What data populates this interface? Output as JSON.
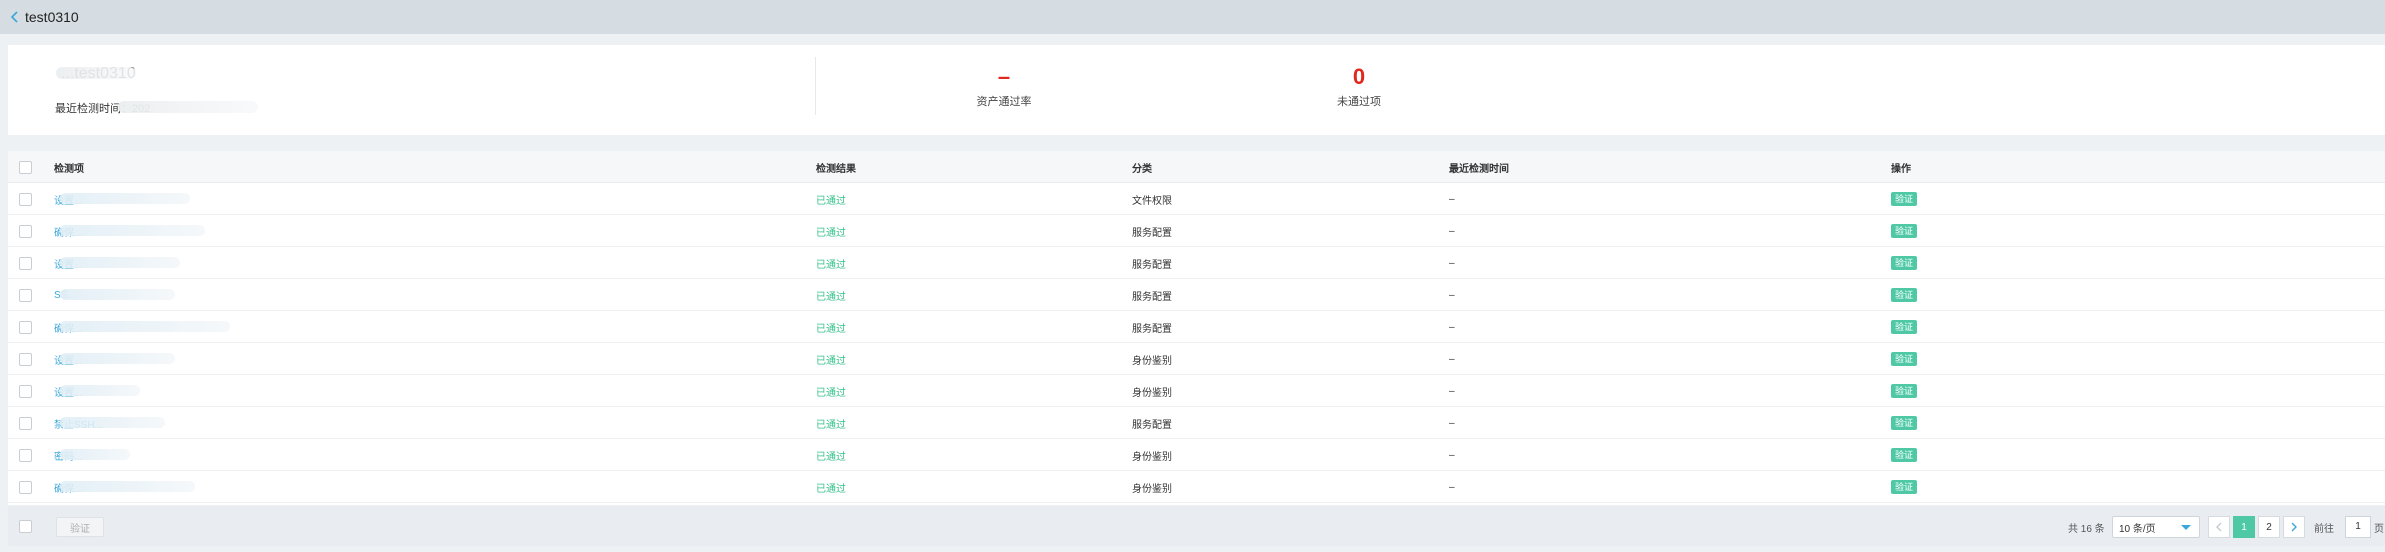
{
  "header": {
    "title": "test0310"
  },
  "summary": {
    "asset_name": "...test0310",
    "last_check_label": "最近检测时间：",
    "last_check_value": "202",
    "stats": [
      {
        "value": "–",
        "label": "资产通过率"
      },
      {
        "value": "0",
        "label": "未通过项"
      }
    ]
  },
  "table": {
    "columns": [
      "检测项",
      "检测结果",
      "分类",
      "最近检测时间",
      "操作"
    ],
    "rows": [
      {
        "item": "设置...",
        "result": "已通过",
        "category": "文件权限",
        "time": "–",
        "action": "验证"
      },
      {
        "item": "确保...",
        "result": "已通过",
        "category": "服务配置",
        "time": "–",
        "action": "验证"
      },
      {
        "item": "设置...",
        "result": "已通过",
        "category": "服务配置",
        "time": "–",
        "action": "验证"
      },
      {
        "item": "SS...",
        "result": "已通过",
        "category": "服务配置",
        "time": "–",
        "action": "验证"
      },
      {
        "item": "确保...",
        "result": "已通过",
        "category": "服务配置",
        "time": "–",
        "action": "验证"
      },
      {
        "item": "设置...",
        "result": "已通过",
        "category": "身份鉴别",
        "time": "–",
        "action": "验证"
      },
      {
        "item": "设置...",
        "result": "已通过",
        "category": "身份鉴别",
        "time": "–",
        "action": "验证"
      },
      {
        "item": "禁止SSH...",
        "result": "已通过",
        "category": "服务配置",
        "time": "–",
        "action": "验证"
      },
      {
        "item": "密码...",
        "result": "已通过",
        "category": "身份鉴别",
        "time": "–",
        "action": "验证"
      },
      {
        "item": "确保...",
        "result": "已通过",
        "category": "身份鉴别",
        "time": "–",
        "action": "验证"
      }
    ]
  },
  "footer": {
    "bulk_verify_label": "验证",
    "total_text": "共 16 条",
    "page_size": "10 条/页",
    "pages": [
      "1",
      "2"
    ],
    "current_page": "1",
    "goto_label": "前往",
    "goto_value": "1",
    "page_unit": "页"
  },
  "colors": {
    "accent": "#4fc9a5",
    "link": "#3aa7d9",
    "pass": "#35c08a",
    "danger": "#e0281c"
  },
  "icons": [
    "chevron-left-icon",
    "caret-down-icon",
    "chevron-left-icon",
    "chevron-right-icon"
  ]
}
